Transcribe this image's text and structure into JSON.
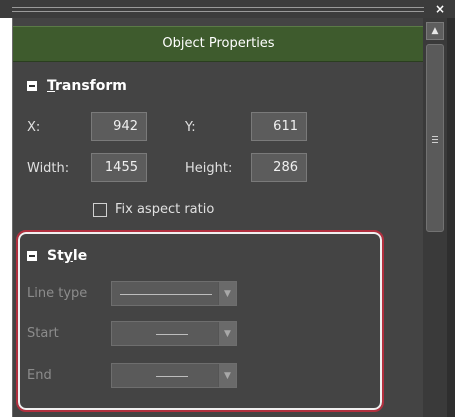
{
  "window": {
    "close_glyph": "×"
  },
  "header": {
    "title": "Object Properties"
  },
  "transform": {
    "title": "Transform",
    "title_underline": "T",
    "title_rest": "ransform",
    "x_label": "X:",
    "x_value": "942",
    "y_label": "Y:",
    "y_value": "611",
    "width_label": "Width:",
    "width_value": "1455",
    "height_label": "Height:",
    "height_value": "286",
    "fix_aspect_label": "Fix aspect ratio",
    "fix_aspect_checked": false
  },
  "style": {
    "title_pre": "St",
    "title_underline": "y",
    "title_post": "le",
    "line_type_label": "Line type",
    "start_label": "Start",
    "end_label": "End",
    "enabled": false
  },
  "colors": {
    "header_bg": "#3e5b2d",
    "panel_bg": "#444444",
    "highlight_border": "#b2303f",
    "disabled_text": "#8c8c8c"
  },
  "icons": {
    "collapse": "minus-box-icon",
    "dropdown": "chevron-down-icon",
    "scroll_up": "triangle-up-icon",
    "close": "close-icon"
  }
}
